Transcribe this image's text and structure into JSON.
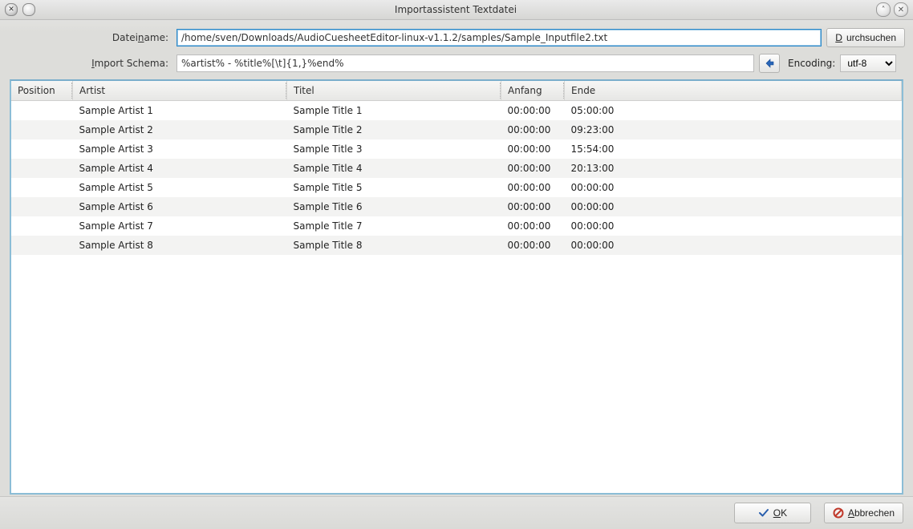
{
  "window": {
    "title": "Importassistent Textdatei"
  },
  "form": {
    "filename_label_pre": "Datei",
    "filename_label_u": "n",
    "filename_label_post": "ame:",
    "filename_value": "/home/sven/Downloads/AudioCuesheetEditor-linux-v1.1.2/samples/Sample_Inputfile2.txt",
    "browse_label_u": "D",
    "browse_label_post": "urchsuchen",
    "schema_label_u": "I",
    "schema_label_post": "mport Schema:",
    "schema_value": "%artist% - %title%[\\t]{1,}%end%",
    "encoding_label": "Encoding:",
    "encoding_value": "utf-8"
  },
  "table": {
    "headers": [
      "Position",
      "Artist",
      "Titel",
      "Anfang",
      "Ende"
    ],
    "rows": [
      {
        "position": "",
        "artist": "Sample Artist 1",
        "title": "Sample Title 1",
        "start": "00:00:00",
        "end": "05:00:00"
      },
      {
        "position": "",
        "artist": "Sample Artist 2",
        "title": "Sample Title 2",
        "start": "00:00:00",
        "end": "09:23:00"
      },
      {
        "position": "",
        "artist": "Sample Artist 3",
        "title": "Sample Title 3",
        "start": "00:00:00",
        "end": "15:54:00"
      },
      {
        "position": "",
        "artist": "Sample Artist 4",
        "title": "Sample Title 4",
        "start": "00:00:00",
        "end": "20:13:00"
      },
      {
        "position": "",
        "artist": "Sample Artist 5",
        "title": "Sample Title 5",
        "start": "00:00:00",
        "end": "00:00:00"
      },
      {
        "position": "",
        "artist": "Sample Artist 6",
        "title": "Sample Title 6",
        "start": "00:00:00",
        "end": "00:00:00"
      },
      {
        "position": "",
        "artist": "Sample Artist 7",
        "title": "Sample Title 7",
        "start": "00:00:00",
        "end": "00:00:00"
      },
      {
        "position": "",
        "artist": "Sample Artist 8",
        "title": "Sample Title 8",
        "start": "00:00:00",
        "end": "00:00:00"
      }
    ]
  },
  "footer": {
    "ok_u": "O",
    "ok_post": "K",
    "cancel_u": "A",
    "cancel_post": "bbrechen"
  }
}
